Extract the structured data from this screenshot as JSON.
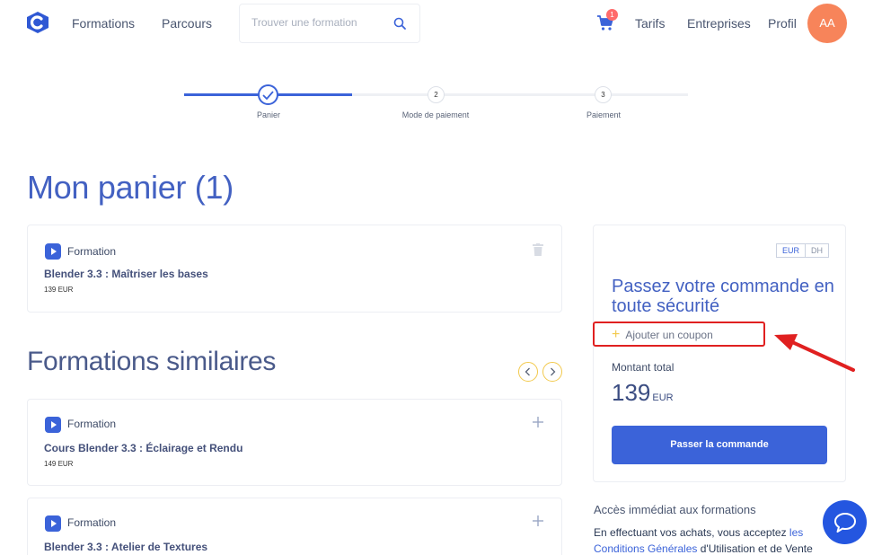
{
  "header": {
    "nav": [
      "Formations",
      "Parcours"
    ],
    "search_placeholder": "Trouver une formation",
    "cart_count": "1",
    "right_nav": [
      "Tarifs",
      "Entreprises",
      "Profil"
    ],
    "avatar_initials": "AA"
  },
  "stepper": {
    "steps": [
      {
        "label": "Panier",
        "number": "",
        "status": "done"
      },
      {
        "label": "Mode de paiement",
        "number": "2",
        "status": "pending"
      },
      {
        "label": "Paiement",
        "number": "3",
        "status": "pending"
      }
    ]
  },
  "cart": {
    "title": "Mon panier (1)",
    "items": [
      {
        "type": "Formation",
        "title": "Blender 3.3 : Maîtriser les bases",
        "price": "139 EUR"
      }
    ]
  },
  "similar": {
    "title": "Formations similaires",
    "items": [
      {
        "type": "Formation",
        "title": "Cours Blender 3.3 : Éclairage et Rendu",
        "price": "149 EUR"
      },
      {
        "type": "Formation",
        "title": "Blender 3.3 : Atelier de Textures",
        "price": ""
      }
    ]
  },
  "order": {
    "currencies": [
      "EUR",
      "DH"
    ],
    "selected_currency": "EUR",
    "title": "Passez votre commande en toute sécurité",
    "coupon_label": "Ajouter un coupon",
    "total_label": "Montant total",
    "total_amount": "139",
    "total_currency": "EUR",
    "button_label": "Passer la commande"
  },
  "footer_info": {
    "access_title": "Accès immédiat aux formations",
    "terms_prefix": "En effectuant vos achats, vous acceptez ",
    "terms_link_1": "les Conditions Générales",
    "terms_middle": " d'Utilisation et de Vente"
  },
  "colors": {
    "primary": "#3b63d9",
    "title_blue": "#4361c2",
    "accent_yellow": "#f2c94c",
    "avatar_orange": "#f7845a",
    "highlight_red": "#e02020"
  },
  "icons": [
    "logo-icon",
    "search-icon",
    "cart-icon",
    "check-icon",
    "play-icon",
    "trash-icon",
    "plus-icon",
    "chevron-left-icon",
    "chevron-right-icon",
    "chat-icon",
    "arrow-annotation"
  ]
}
